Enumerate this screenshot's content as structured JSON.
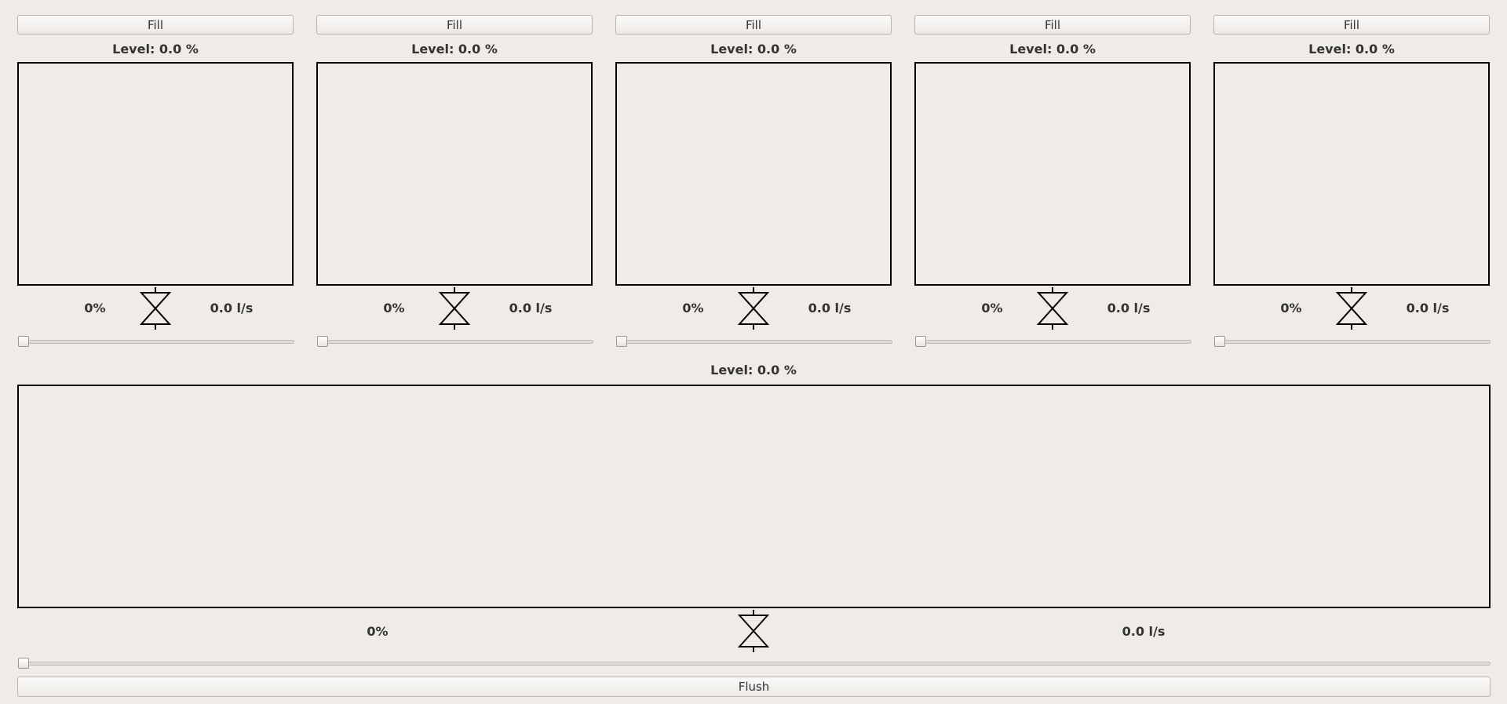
{
  "tanks": [
    {
      "fill_label": "Fill",
      "level_text": "Level: 0.0 %",
      "level": 0.0,
      "valve_percent": "0%",
      "flow_text": "0.0 l/s",
      "slider": 0.0
    },
    {
      "fill_label": "Fill",
      "level_text": "Level: 0.0 %",
      "level": 0.0,
      "valve_percent": "0%",
      "flow_text": "0.0 l/s",
      "slider": 0.0
    },
    {
      "fill_label": "Fill",
      "level_text": "Level: 0.0 %",
      "level": 0.0,
      "valve_percent": "0%",
      "flow_text": "0.0 l/s",
      "slider": 0.0
    },
    {
      "fill_label": "Fill",
      "level_text": "Level: 0.0 %",
      "level": 0.0,
      "valve_percent": "0%",
      "flow_text": "0.0 l/s",
      "slider": 0.0
    },
    {
      "fill_label": "Fill",
      "level_text": "Level: 0.0 %",
      "level": 0.0,
      "valve_percent": "0%",
      "flow_text": "0.0 l/s",
      "slider": 0.0
    }
  ],
  "main_tank": {
    "level_text": "Level: 0.0 %",
    "level": 0.0,
    "valve_percent": "0%",
    "flow_text": "0.0 l/s",
    "slider": 0.0,
    "flush_label": "Flush"
  },
  "icons": {
    "valve": "valve-icon"
  }
}
